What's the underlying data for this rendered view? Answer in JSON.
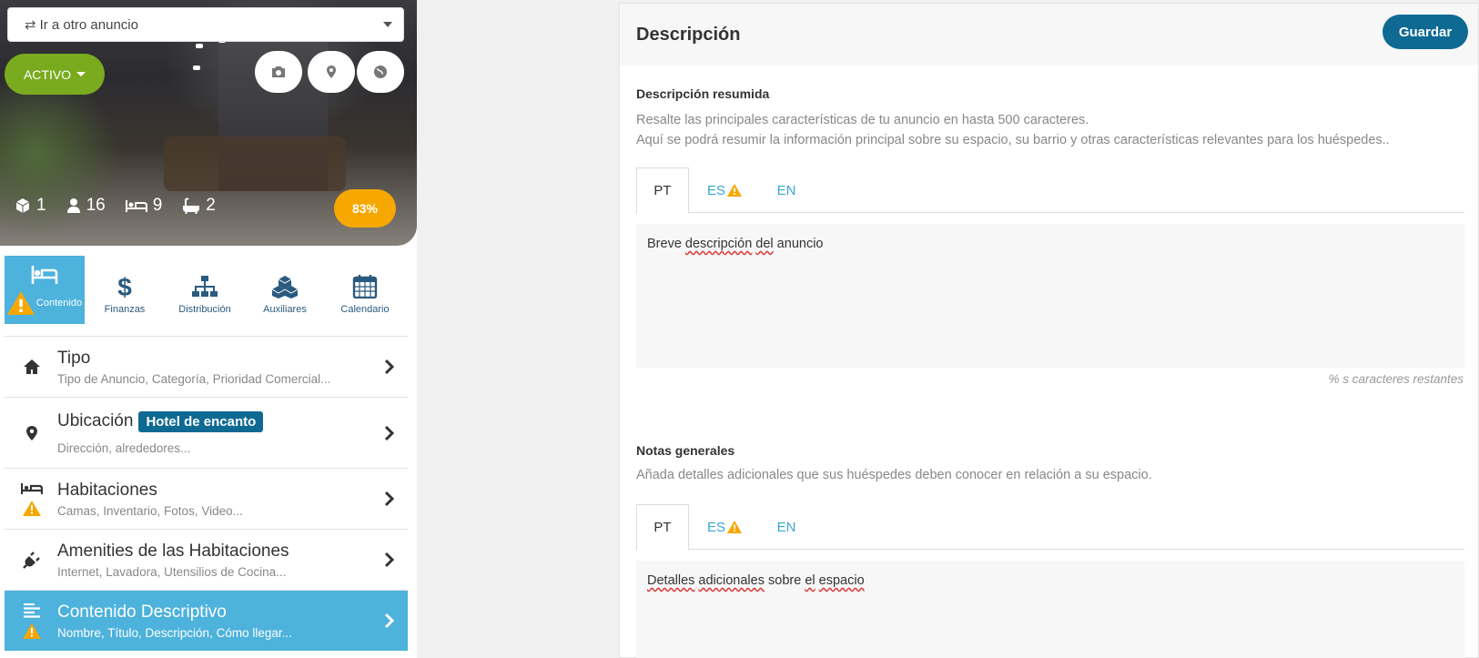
{
  "sidebar": {
    "listing_selector": "Ir a otro anuncio",
    "status": "ACTIVO",
    "stats": {
      "units": "1",
      "guests": "16",
      "beds": "9",
      "baths": "2"
    },
    "completion": "83%",
    "tabs": [
      {
        "label": "Contenido",
        "icon": "bed-icon",
        "active": true,
        "warning": true
      },
      {
        "label": "Finanzas",
        "icon": "dollar-icon"
      },
      {
        "label": "Distribución",
        "icon": "sitemap-icon"
      },
      {
        "label": "Auxiliares",
        "icon": "cubes-icon"
      },
      {
        "label": "Calendario",
        "icon": "calendar-icon"
      }
    ],
    "menu": [
      {
        "title": "Tipo",
        "subtitle": "Tipo de Anuncio, Categoría, Prioridad Comercial...",
        "icon": "home-icon"
      },
      {
        "title": "Ubicación",
        "badge": "Hotel de encanto",
        "subtitle": "Dirección, alrededores...",
        "icon": "map-pin-icon"
      },
      {
        "title": "Habitaciones",
        "subtitle": "Camas, Inventario, Fotos, Video...",
        "icon": "bed-icon",
        "warning": true
      },
      {
        "title": "Amenities de las Habitaciones",
        "subtitle": "Internet, Lavadora, Utensilios de Cocina...",
        "icon": "plug-icon"
      },
      {
        "title": "Contenido Descriptivo",
        "subtitle": "Nombre, Título, Descripción, Cómo llegar...",
        "icon": "align-left-icon",
        "warning": true,
        "active": true
      }
    ]
  },
  "panel": {
    "title": "Descripción",
    "save_label": "Guardar",
    "summary": {
      "title": "Descripción resumida",
      "hint_line1": "Resalte las principales características de tu anuncio en hasta 500 caracteres.",
      "hint_line2": "Aquí se podrá resumir la información principal sobre su espacio, su barrio y otras características relevantes para los huéspedes..",
      "langs": [
        "PT",
        "ES",
        "EN"
      ],
      "text_plain1": "Breve ",
      "text_spell1": "descripción",
      "text_plain2": " ",
      "text_spell2": "del",
      "text_plain3": " anuncio",
      "counter": "% s caracteres restantes"
    },
    "notes": {
      "title": "Notas generales",
      "hint": "Añada detalles adicionales que sus huéspedes deben conocer en relación a su espacio.",
      "langs": [
        "PT",
        "ES",
        "EN"
      ],
      "text_spell1": "Detalles",
      "text_plain1": " ",
      "text_spell2": "adicionales",
      "text_plain2": " sobre ",
      "text_spell3": "el",
      "text_plain3": " ",
      "text_spell4": "espacio"
    }
  },
  "colors": {
    "accent": "#4db2dc",
    "primary": "#0f6a93",
    "status_green": "#7aaa1e",
    "warning": "#f7a800"
  }
}
